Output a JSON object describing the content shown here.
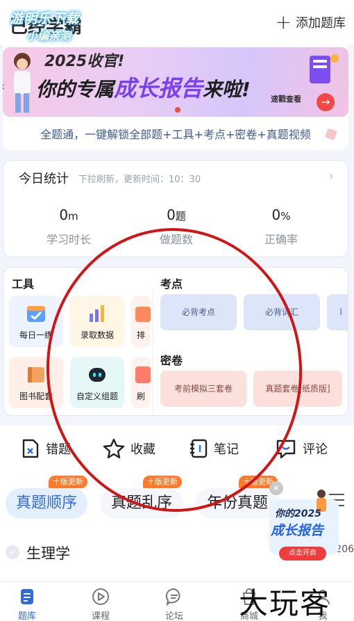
{
  "watermark": {
    "top_line1": "游明乐下载",
    "top_line2": "小编亲测",
    "bottom_right": "大玩客"
  },
  "header": {
    "title": "已经学霸",
    "add_button_label": "添加题库"
  },
  "banner": {
    "line1": "2025收官!",
    "line2_prefix": "你的专属",
    "line2_highlight": "成长报告",
    "line2_suffix": "来啦!",
    "quick_view": "速戳查看",
    "dots_total": 3,
    "dots_active_index": 1
  },
  "unlock_text": "全题通，一键解锁全部题+工具+考点+密卷+真题视频",
  "stats": {
    "title": "今日统计",
    "subtitle": "下拉刷新，更新时间：10：30",
    "items": [
      {
        "value": "0",
        "unit": "m",
        "label": "学习时长"
      },
      {
        "value": "0",
        "unit": "题",
        "label": "做题数"
      },
      {
        "value": "0",
        "unit": "%",
        "label": "正确率"
      }
    ]
  },
  "tools": {
    "title": "工具",
    "items": [
      {
        "label": "每日一练",
        "icon": "calendar-icon"
      },
      {
        "label": "录取数据",
        "icon": "data-chart-icon"
      },
      {
        "label": "排",
        "icon": "ranking-icon"
      },
      {
        "label": "图书配套",
        "icon": "book-icon"
      },
      {
        "label": "自定义组题",
        "icon": "robot-icon"
      },
      {
        "label": "刷",
        "icon": "practice-icon"
      }
    ]
  },
  "kaodian": {
    "title": "考点",
    "chips": [
      "必背考点",
      "必背词汇",
      "l"
    ]
  },
  "mijuan": {
    "title": "密卷",
    "chips": [
      "考前模拟三套卷",
      "真题套卷[纸质版]"
    ]
  },
  "actions": [
    {
      "label": "错题",
      "icon": "wrong-question-icon"
    },
    {
      "label": "收藏",
      "icon": "star-icon"
    },
    {
      "label": "笔记",
      "icon": "notebook-icon"
    },
    {
      "label": "评论",
      "icon": "comment-icon"
    }
  ],
  "tabs": [
    {
      "label": "真题顺序",
      "badge": "十版更新",
      "active": true
    },
    {
      "label": "真题乱序",
      "badge": "十版更新",
      "active": false
    },
    {
      "label": "年份真题",
      "badge": "十版更新",
      "active": false
    }
  ],
  "subject": {
    "name": "生理学",
    "count": "0/1206"
  },
  "float_promo": {
    "line1": "你的2025",
    "line2": "成长报告",
    "button": "点击开启"
  },
  "bottom_nav": [
    {
      "label": "题库",
      "icon": "question-bank-icon",
      "active": true
    },
    {
      "label": "课程",
      "icon": "play-icon",
      "active": false
    },
    {
      "label": "论坛",
      "icon": "forum-icon",
      "active": false
    },
    {
      "label": "商城",
      "icon": "shop-icon",
      "active": false
    },
    {
      "label": "我",
      "icon": "profile-icon",
      "active": false
    }
  ],
  "colors": {
    "accent_blue": "#2f6ae0",
    "badge_orange": "#ff7a2b",
    "annotation_red": "#d21414",
    "banner_purple": "#7b3ff2"
  }
}
